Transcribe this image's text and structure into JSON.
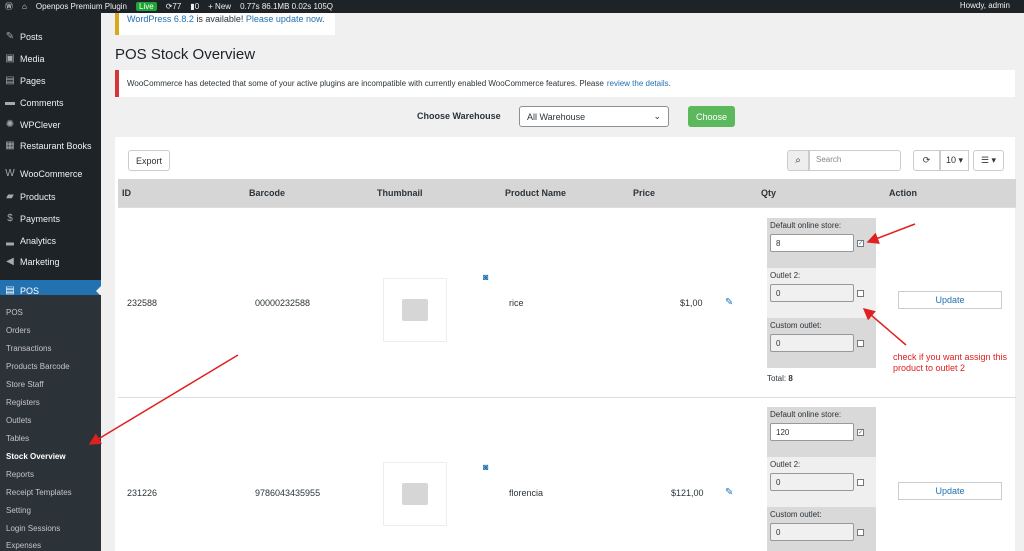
{
  "adminbar": {
    "site": "Openpos Premium Plugin",
    "live": "Live",
    "updates": "77",
    "comments": "0",
    "new": "+ New",
    "perf": "0.77s  86.1MB  0.02s  105Q",
    "howdy": "Howdy, admin"
  },
  "sidebar": {
    "items": [
      {
        "label": "Posts",
        "icon": "pin-icon"
      },
      {
        "label": "Media",
        "icon": "media-icon"
      },
      {
        "label": "Pages",
        "icon": "pages-icon"
      },
      {
        "label": "Comments",
        "icon": "comments-icon"
      },
      {
        "label": "WPClever",
        "icon": "wpclever-icon"
      },
      {
        "label": "Restaurant Books",
        "icon": "calendar-icon"
      },
      {
        "label": "WooCommerce",
        "icon": "woo-icon"
      },
      {
        "label": "Products",
        "icon": "products-icon"
      },
      {
        "label": "Payments",
        "icon": "payments-icon"
      },
      {
        "label": "Analytics",
        "icon": "analytics-icon"
      },
      {
        "label": "Marketing",
        "icon": "marketing-icon"
      },
      {
        "label": "POS",
        "icon": "pos-icon"
      }
    ],
    "submenu": [
      "POS",
      "Orders",
      "Transactions",
      "Products Barcode",
      "Store Staff",
      "Registers",
      "Outlets",
      "Tables",
      "Stock Overview",
      "Reports",
      "Receipt Templates",
      "Setting",
      "Login Sessions",
      "Expenses"
    ]
  },
  "notice_update": {
    "link1": "WordPress 6.8.2",
    "text": " is available! ",
    "link2": "Please update now",
    "end": "."
  },
  "page_title": "POS Stock Overview",
  "notice_error": {
    "text": "WooCommerce has detected that some of your active plugins are incompatible with currently enabled WooCommerce features. Please",
    "link": "review the details",
    "end": "."
  },
  "warehouse": {
    "label": "Choose Warehouse",
    "selected": "All Warehouse",
    "button": "Choose"
  },
  "toolbar": {
    "export": "Export",
    "search_placeholder": "Search",
    "page_size": "10 ▾",
    "columns": "☰ ▾"
  },
  "table": {
    "headers": [
      "ID",
      "Barcode",
      "Thumbnail",
      "Product Name",
      "Price",
      "Qty",
      "Action"
    ],
    "rows": [
      {
        "id": "232588",
        "barcode": "00000232588",
        "name": "rice",
        "price": "$1,00",
        "qty": [
          {
            "label": "Default online store:",
            "value": "8",
            "checked": true
          },
          {
            "label": "Outlet 2:",
            "value": "0",
            "checked": false
          },
          {
            "label": "Custom outlet:",
            "value": "0",
            "checked": false
          }
        ],
        "total_label": "Total:",
        "total": "8",
        "action": "Update"
      },
      {
        "id": "231226",
        "barcode": "9786043435955",
        "name": "florencia",
        "price": "$121,00",
        "qty": [
          {
            "label": "Default online store:",
            "value": "120",
            "checked": true
          },
          {
            "label": "Outlet 2:",
            "value": "0",
            "checked": false
          },
          {
            "label": "Custom outlet:",
            "value": "0",
            "checked": false
          }
        ],
        "action": "Update"
      }
    ]
  },
  "annotation": "check if you want assign this product to outlet 2",
  "colors": {
    "accent": "#2271b1",
    "choose": "#5cb85c",
    "annotation": "#e02020"
  }
}
